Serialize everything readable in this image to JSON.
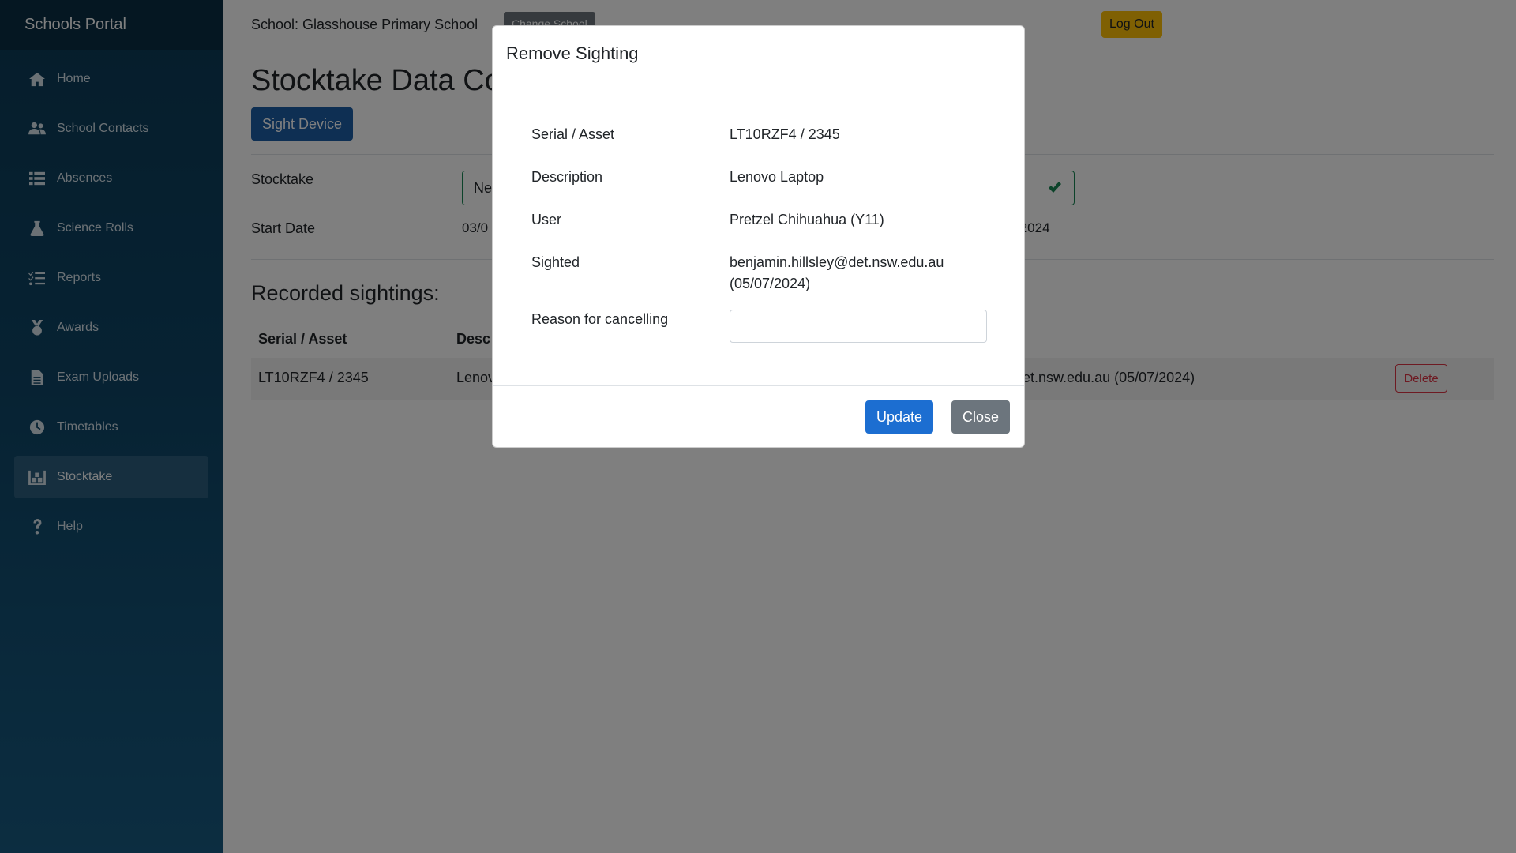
{
  "brand": "Schools Portal",
  "sidebar": {
    "items": [
      {
        "label": "Home",
        "icon": "home-icon"
      },
      {
        "label": "School Contacts",
        "icon": "users-icon"
      },
      {
        "label": "Absences",
        "icon": "list-icon"
      },
      {
        "label": "Science Rolls",
        "icon": "flask-icon"
      },
      {
        "label": "Reports",
        "icon": "checklist-icon"
      },
      {
        "label": "Awards",
        "icon": "medal-icon"
      },
      {
        "label": "Exam Uploads",
        "icon": "file-icon"
      },
      {
        "label": "Timetables",
        "icon": "clock-icon"
      },
      {
        "label": "Stocktake",
        "icon": "warehouse-icon",
        "active": true
      },
      {
        "label": "Help",
        "icon": "question-icon"
      }
    ]
  },
  "header": {
    "school_label": "School: Glasshouse Primary School",
    "change_school": "Change School",
    "logout": "Log Out"
  },
  "main": {
    "title": "Stocktake Data Col",
    "sight_device": "Sight Device",
    "stocktake_label": "Stocktake",
    "stocktake_value": "Ne",
    "start_date_label": "Start Date",
    "start_date_value": "03/0",
    "end_date_value": "/2024",
    "recorded_title": "Recorded sightings:",
    "columns": [
      "Serial / Asset",
      "Desc"
    ],
    "rows": [
      {
        "serial": "LT10RZF4 / 2345",
        "desc": "Lenov",
        "sighted": "et.nsw.edu.au (05/07/2024)",
        "action": "Delete"
      }
    ]
  },
  "modal": {
    "title": "Remove Sighting",
    "fields": [
      {
        "label": "Serial / Asset",
        "value": "LT10RZF4 / 2345"
      },
      {
        "label": "Description",
        "value": "Lenovo Laptop"
      },
      {
        "label": "User",
        "value": "Pretzel Chihuahua (Y11)"
      },
      {
        "label": "Sighted",
        "value": "benjamin.hillsley@det.nsw.edu.au",
        "value2": "(05/07/2024)"
      }
    ],
    "reason_label": "Reason for cancelling",
    "reason_value": "",
    "update": "Update",
    "close": "Close"
  },
  "colors": {
    "sidebar_top": "#0b3b57",
    "primary": "#1c6ed1",
    "warning": "#ffc107",
    "danger": "#dc3545",
    "success": "#198754",
    "secondary": "#6c757d"
  }
}
